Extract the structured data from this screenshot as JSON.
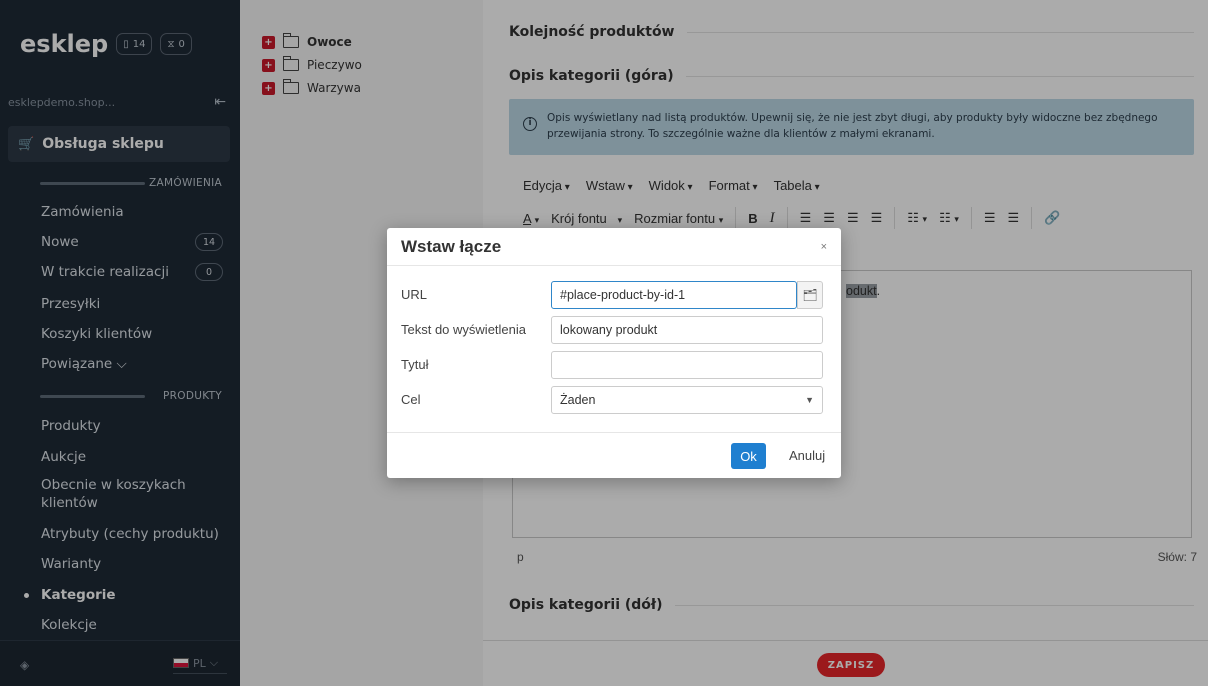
{
  "sidebar": {
    "logo": "esklep",
    "orders_count": "14",
    "pending_count": "0",
    "store_name": "esklepdemo.shop...",
    "section": "Obsługa sklepu",
    "group_orders": "ZAMÓWIENIA",
    "group_products": "PRODUKTY",
    "items": [
      {
        "label": "Zamówienia"
      },
      {
        "label": "Nowe",
        "badge": "14"
      },
      {
        "label": "W trakcie realizacji",
        "badge": "0"
      },
      {
        "label": "Przesyłki"
      },
      {
        "label": "Koszyki klientów"
      },
      {
        "label": "Powiązane ⌵"
      },
      {
        "label": "Produkty"
      },
      {
        "label": "Aukcje"
      },
      {
        "label": "Obecnie w koszykach klientów"
      },
      {
        "label": "Atrybuty (cechy produktu)"
      },
      {
        "label": "Warianty"
      },
      {
        "label": "Kategorie"
      },
      {
        "label": "Kolekcje"
      }
    ],
    "language": "PL"
  },
  "tree": {
    "items": [
      {
        "label": "Owoce"
      },
      {
        "label": "Pieczywo"
      },
      {
        "label": "Warzywa"
      }
    ]
  },
  "main": {
    "section_order": "Kolejność produktów",
    "section_desc_top": "Opis kategorii (góra)",
    "info_text": "Opis wyświetlany nad listą produktów. Upewnij się, że nie jest zbyt długi, aby produkty były widoczne bez zbędnego przewijania strony. To szczególnie ważne dla klientów z małymi ekranami.",
    "menu": [
      "Edycja",
      "Wstaw",
      "Widok",
      "Format",
      "Tabela"
    ],
    "toolbar": {
      "font_family": "Krój fontu",
      "font_size": "Rozmiar fontu"
    },
    "editor_visible_text": "odukt",
    "editor_after": ".",
    "status_path": "p",
    "word_count": "Słów: 7",
    "section_desc_bottom": "Opis kategorii (dół)",
    "save_label": "ZAPISZ"
  },
  "modal": {
    "title": "Wstaw łącze",
    "close": "×",
    "url_label": "URL",
    "url_value": "#place-product-by-id-1",
    "text_label": "Tekst do wyświetlenia",
    "text_value": "lokowany produkt",
    "title_label": "Tytuł",
    "title_value": "",
    "target_label": "Cel",
    "target_value": "Żaden",
    "ok_label": "Ok",
    "cancel_label": "Anuluj"
  }
}
